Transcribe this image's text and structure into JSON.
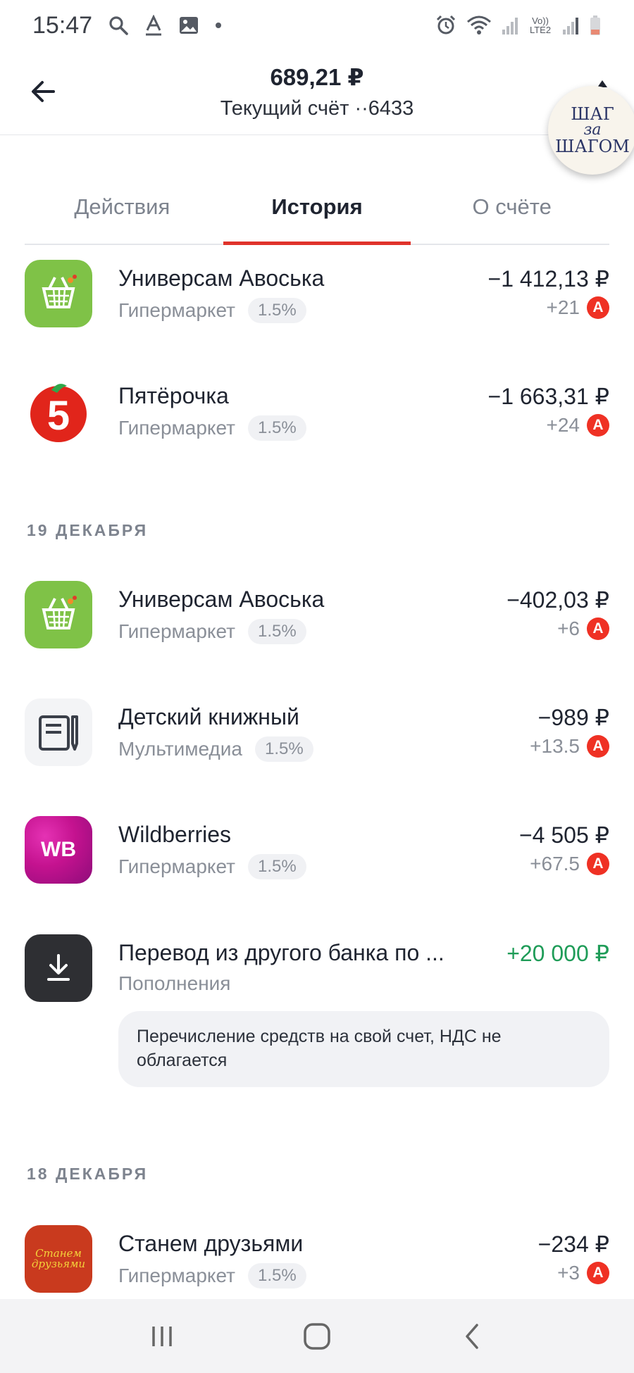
{
  "status_bar": {
    "time": "15:47",
    "left_icons": [
      "search-icon",
      "text-icon",
      "image-icon",
      "dot-icon"
    ],
    "right_icons": [
      "alarm-icon",
      "wifi-icon",
      "signal-icon",
      "volte-icon",
      "signal-icon",
      "battery-icon"
    ],
    "volte_text": "Vo)) LTE2"
  },
  "header": {
    "amount": "689,21 ₽",
    "account": "Текущий счёт ··6433"
  },
  "badge": {
    "line1": "ШАГ",
    "line2": "за",
    "line3": "ШАГОМ"
  },
  "tabs": [
    {
      "label": "Действия",
      "active": false
    },
    {
      "label": "История",
      "active": true
    },
    {
      "label": "О счёте",
      "active": false
    }
  ],
  "transactions": [
    {
      "name": "Универсам Авоська",
      "category": "Гипермаркет",
      "cashback": "1.5%",
      "amount": "−1 412,13 ₽",
      "bonus": "+21",
      "logo": "avoska-basket-icon"
    },
    {
      "name": "Пятёрочка",
      "category": "Гипермаркет",
      "cashback": "1.5%",
      "amount": "−1 663,31 ₽",
      "bonus": "+24",
      "logo": "pyaterochka-5-icon"
    }
  ],
  "date_groups": [
    {
      "date": "19 ДЕКАБРЯ",
      "items": [
        {
          "name": "Универсам Авоська",
          "category": "Гипермаркет",
          "cashback": "1.5%",
          "amount": "−402,03 ₽",
          "bonus": "+6",
          "logo": "avoska-basket-icon"
        },
        {
          "name": "Детский книжный",
          "category": "Мультимедиа",
          "cashback": "1.5%",
          "amount": "−989 ₽",
          "bonus": "+13.5",
          "logo": "book-icon"
        },
        {
          "name": "Wildberries",
          "category": "Гипермаркет",
          "cashback": "1.5%",
          "amount": "−4 505 ₽",
          "bonus": "+67.5",
          "logo": "wb-icon",
          "logo_text": "WB"
        },
        {
          "name": "Перевод из другого банка по ...",
          "category": "Пополнения",
          "amount": "+20 000 ₽",
          "logo": "download-icon",
          "note": "Перечисление средств на свой счет, НДС не облагается"
        }
      ]
    },
    {
      "date": "18 ДЕКАБРЯ",
      "items": [
        {
          "name": "Станем друзьями",
          "category": "Гипермаркет",
          "cashback": "1.5%",
          "amount": "−234 ₽",
          "bonus": "+3",
          "logo": "stanem-druzyami-icon",
          "logo_text": "Станем друзьями"
        }
      ]
    }
  ],
  "bonus_badge_letter": "А",
  "colors": {
    "accent_red": "#e0332b",
    "alfa_red": "#ef3124",
    "income_green": "#1f9c58"
  },
  "nav": [
    "recent-apps-icon",
    "home-icon",
    "back-icon"
  ]
}
